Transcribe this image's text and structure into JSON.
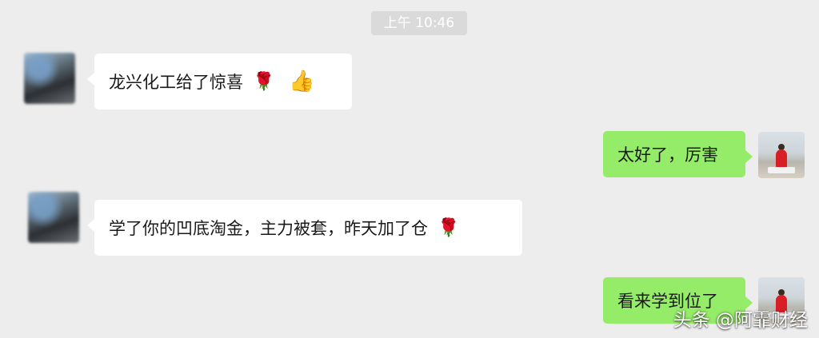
{
  "chat": {
    "timestamp": "上午 10:46",
    "messages": [
      {
        "side": "left",
        "text": "龙兴化工给了惊喜",
        "emojis": [
          "rose-icon",
          "thumbs-up-icon"
        ]
      },
      {
        "side": "right",
        "text": "太好了，厉害"
      },
      {
        "side": "left",
        "text": "学了你的凹底淘金，主力被套，昨天加了仓",
        "emojis": [
          "rose-icon"
        ]
      },
      {
        "side": "right",
        "text": "看来学到位了"
      }
    ]
  },
  "watermark": {
    "text": "头条 @阿霏财经"
  },
  "colors": {
    "background": "#ededed",
    "sent_bubble": "#95ec69",
    "received_bubble": "#ffffff"
  }
}
